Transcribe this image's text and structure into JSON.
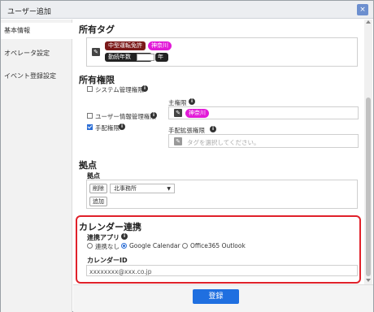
{
  "window": {
    "title": "ユーザー追加",
    "close_label": "×"
  },
  "sidebar": {
    "items": [
      {
        "label": "基本情報",
        "active": true
      },
      {
        "label": "オペレータ設定",
        "active": false
      },
      {
        "label": "イベント登録設定",
        "active": false
      }
    ]
  },
  "tags_section": {
    "title": "所有タグ",
    "tags": [
      {
        "label": "中型運転免許",
        "color": "#7b1a1a"
      },
      {
        "label": "神奈川",
        "color": "#e21bd8"
      }
    ],
    "years_label": "勤続年数",
    "years_value": "",
    "years_unit": "年"
  },
  "permissions": {
    "title": "所有権限",
    "items": [
      {
        "label": "システム管理権限",
        "checked": false
      },
      {
        "label": "ユーザー情報管理権限",
        "checked": false
      },
      {
        "label": "手配権限",
        "checked": true
      }
    ],
    "main_label": "主権限",
    "main_tag": "神奈川",
    "ext_label": "手配拡張権限",
    "ext_placeholder": "タグを選択してください。"
  },
  "base": {
    "title": "拠点",
    "sub_label": "拠点",
    "delete_label": "削除",
    "selected": "北事務所",
    "add_label": "追加"
  },
  "calendar": {
    "title": "カレンダー連携",
    "app_label": "連携アプリ",
    "options": [
      {
        "label": "連携なし",
        "selected": false
      },
      {
        "label": "Google Calendar",
        "selected": true
      },
      {
        "label": "Office365 Outlook",
        "selected": false
      }
    ],
    "id_label": "カレンダーID",
    "id_value": "xxxxxxxx@xxx.co.jp"
  },
  "footer": {
    "submit_label": "登録"
  },
  "icons": {
    "info": "info-icon",
    "pencil": "pencil-icon"
  },
  "colors": {
    "accent": "#1f6fe0",
    "highlight_border": "#e0212a"
  }
}
